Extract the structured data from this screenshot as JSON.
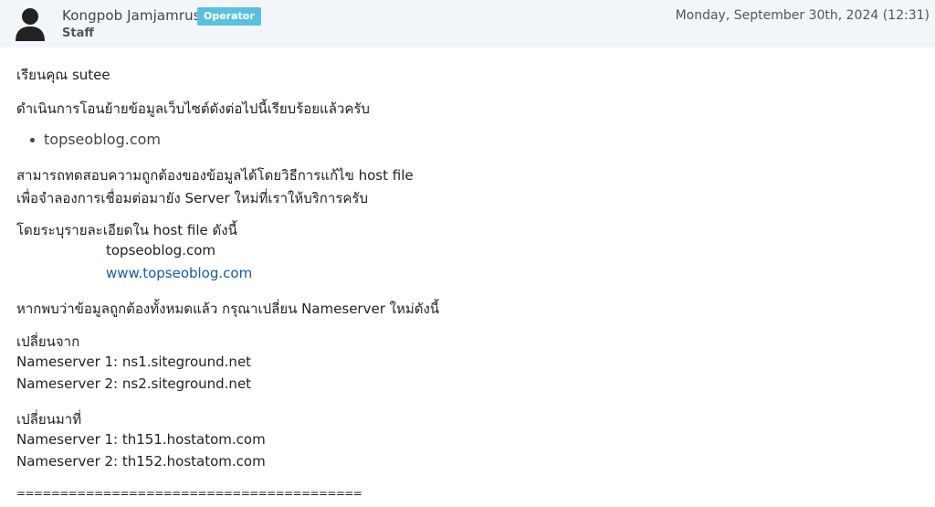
{
  "header": {
    "author_name": "Kongpob Jamjamrus",
    "role_badge": "Operator",
    "author_role": "Staff",
    "post_date": "Monday, September 30th, 2024 (12:31)",
    "avatar_icon": "user-avatar-icon"
  },
  "message": {
    "greeting": "เรียนคุณ sutee",
    "intro": "ดำเนินการโอนย้ายข้อมูลเว็บไซต์ดังต่อไปนี้เรียบร้อยแล้วครับ",
    "domains": [
      "topseoblog.com"
    ],
    "test_line_1": "สามารถทดสอบความถูกต้องของข้อมูลได้โดยวิธีการแก้ไข host file",
    "test_line_2": "เพื่อจำลองการเชื่อมต่อมายัง Server ใหม่ที่เราให้บริการครับ",
    "host_intro": "โดยระบุรายละเอียดใน host file ดังนี้",
    "host_entries": [
      "topseoblog.com",
      "www.topseoblog.com"
    ],
    "nameserver_instruction": "หากพบว่าข้อมูลถูกต้องทั้งหมดแล้ว กรุณาเปลี่ยน Nameserver ใหม่ดังนี้",
    "change_from_label": "เปลี่ยนจาก",
    "old_nameservers": [
      "Nameserver 1: ns1.siteground.net",
      "Nameserver 2: ns2.siteground.net"
    ],
    "change_to_label": "เปลี่ยนมาที่",
    "new_nameservers": [
      "Nameserver 1: th151.hostatom.com",
      "Nameserver 2: th152.hostatom.com"
    ],
    "separator": "========================================"
  },
  "colors": {
    "header_bg": "#f2f6fb",
    "badge_bg": "#5bc0de",
    "link": "#1a5a9a"
  }
}
